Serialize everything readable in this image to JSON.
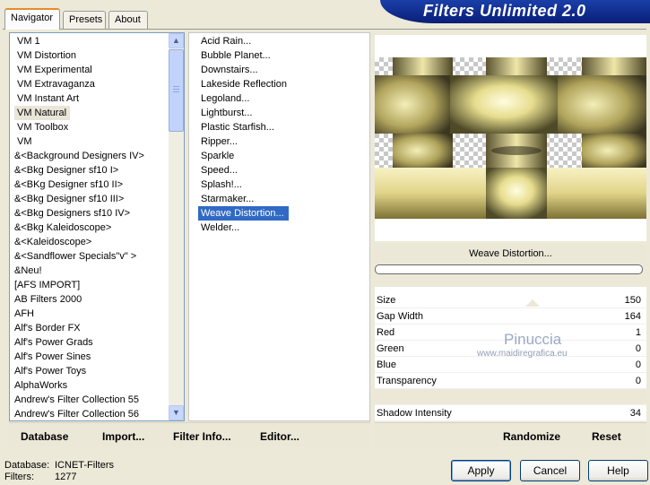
{
  "app": {
    "title": "Filters Unlimited 2.0"
  },
  "tabs": [
    {
      "label": "Navigator"
    },
    {
      "label": "Presets"
    },
    {
      "label": "About"
    }
  ],
  "categories": {
    "items": [
      "VM 1",
      "VM Distortion",
      "VM Experimental",
      "VM Extravaganza",
      "VM Instant Art",
      "VM Natural",
      "VM Toolbox",
      "VM",
      "&<Background Designers IV>",
      "&<Bkg Designer sf10 I>",
      "&<BKg Designer sf10 II>",
      "&<Bkg Designer sf10 III>",
      "&<Bkg Designers sf10 IV>",
      "&<Bkg Kaleidoscope>",
      "&<Kaleidoscope>",
      "&<Sandflower Specials\"v\" >",
      "&Neu!",
      "[AFS IMPORT]",
      "AB Filters 2000",
      "AFH",
      "Alf's Border FX",
      "Alf's Power Grads",
      "Alf's Power Sines",
      "Alf's Power Toys",
      "AlphaWorks",
      "Andrew's Filter Collection 55",
      "Andrew's Filter Collection 56"
    ],
    "selected": "VM Natural"
  },
  "filters": {
    "items": [
      "Acid Rain...",
      "Bubble Planet...",
      "Downstairs...",
      "Lakeside Reflection",
      "Legoland...",
      "Lightburst...",
      "Plastic Starfish...",
      "Ripper...",
      "Sparkle",
      "Speed...",
      "Splash!...",
      "Starmaker...",
      "Weave Distortion...",
      "Welder..."
    ],
    "selected": "Weave Distortion..."
  },
  "toolbar": {
    "database": "Database",
    "import": "Import...",
    "filter_info": "Filter Info...",
    "editor": "Editor...",
    "randomize": "Randomize",
    "reset": "Reset"
  },
  "preview": {
    "filter_name": "Weave Distortion..."
  },
  "params": [
    {
      "label": "Size",
      "value": "150"
    },
    {
      "label": "Gap Width",
      "value": "164"
    },
    {
      "label": "Red",
      "value": "1"
    },
    {
      "label": "Green",
      "value": "0"
    },
    {
      "label": "Blue",
      "value": "0"
    },
    {
      "label": "Transparency",
      "value": "0"
    },
    {
      "label": "",
      "value": ""
    },
    {
      "label": "Shadow Intensity",
      "value": "34"
    }
  ],
  "watermark": {
    "line1": "Pinuccia",
    "line2": "www.maidiregrafica.eu"
  },
  "status": {
    "database_label": "Database:",
    "database_value": "ICNET-Filters",
    "filters_label": "Filters:",
    "filters_value": "1277"
  },
  "buttons": {
    "apply": "Apply",
    "cancel": "Cancel",
    "help": "Help"
  },
  "colors": {
    "banner": "#0a1e78",
    "selection": "#316ac5",
    "tab_accent": "#e68b2c"
  },
  "icons": {
    "scroll_up": "scroll-up-arrow-icon",
    "scroll_down": "scroll-down-arrow-icon"
  }
}
